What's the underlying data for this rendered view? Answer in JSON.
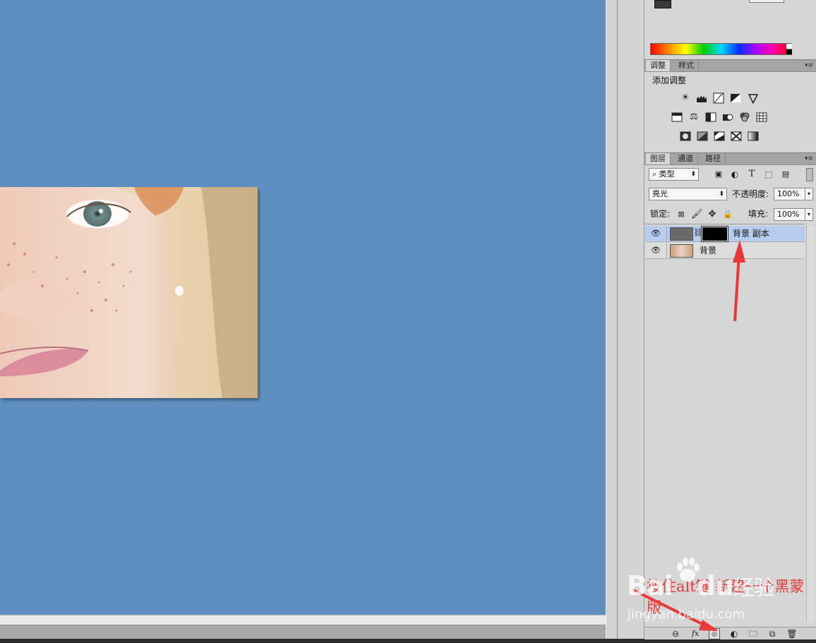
{
  "adjust_panel": {
    "tabs": [
      "调整",
      "样式"
    ],
    "title": "添加调整",
    "row1_icons": [
      "brightness-icon",
      "levels-icon",
      "curves-icon",
      "exposure-icon",
      "vibrance-icon"
    ],
    "row2_icons": [
      "hue-saturation-icon",
      "color-balance-icon",
      "black-white-icon",
      "photo-filter-icon",
      "channel-mixer-icon",
      "color-lookup-icon"
    ],
    "row3_icons": [
      "invert-icon",
      "posterize-icon",
      "threshold-icon",
      "selective-color-icon",
      "gradient-map-icon"
    ]
  },
  "layers_panel": {
    "tabs": [
      "图层",
      "通道",
      "路径"
    ],
    "filter_kind": "类型",
    "blend_mode": "亮光",
    "opacity_label": "不透明度:",
    "opacity_value": "100%",
    "lock_label": "锁定:",
    "fill_label": "填充:",
    "fill_value": "100%",
    "layers": [
      {
        "name": "背景 副本",
        "selected": true,
        "has_mask": true
      },
      {
        "name": "背景",
        "selected": false,
        "has_mask": false
      }
    ],
    "footer_icons": [
      "link-layers-icon",
      "fx-icon",
      "add-mask-icon",
      "adjustment-layer-icon",
      "group-folder-icon",
      "new-layer-icon",
      "trash-icon"
    ],
    "fx_label": "fx"
  },
  "annotation": {
    "text_line1": "按住alt键 新建一个黑蒙",
    "text_line2": "版",
    "color": "#e23b3b"
  },
  "watermark": {
    "brand": "Bai",
    "brand_suffix": "du",
    "cn": "经验",
    "url": "jingyan.baidu.com"
  },
  "colors": {
    "canvas": "#5f8ec0",
    "selected_layer": "#b6cdf0",
    "panel": "#d6d6d6"
  }
}
